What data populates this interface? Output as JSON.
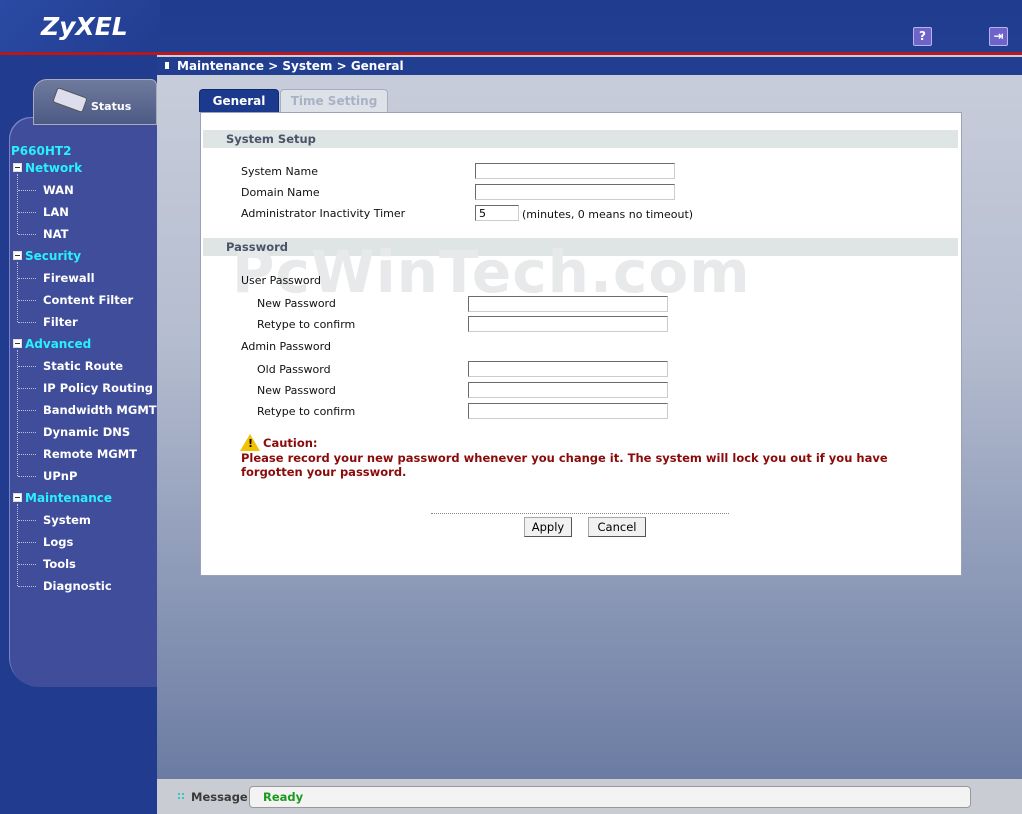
{
  "header": {
    "brand": "ZyXEL",
    "help_icon": "?",
    "logout_icon": "⇥"
  },
  "breadcrumb": "Maintenance > System > General",
  "nav": {
    "status_label": "Status",
    "model": "P660HT2",
    "groups": [
      {
        "label": "Network",
        "items": [
          "WAN",
          "LAN",
          "NAT"
        ]
      },
      {
        "label": "Security",
        "items": [
          "Firewall",
          "Content Filter",
          "Filter"
        ]
      },
      {
        "label": "Advanced",
        "items": [
          "Static Route",
          "IP Policy Routing",
          "Bandwidth MGMT",
          "Dynamic DNS",
          "Remote MGMT",
          "UPnP"
        ]
      },
      {
        "label": "Maintenance",
        "items": [
          "System",
          "Logs",
          "Tools",
          "Diagnostic"
        ]
      }
    ]
  },
  "tabs": {
    "general": "General",
    "time": "Time Setting"
  },
  "system_setup": {
    "title": "System Setup",
    "system_name_label": "System Name",
    "system_name_value": "",
    "domain_name_label": "Domain Name",
    "domain_name_value": "",
    "timer_label": "Administrator Inactivity Timer",
    "timer_value": "5",
    "timer_hint": "(minutes, 0 means no timeout)"
  },
  "password": {
    "title": "Password",
    "user_password_label": "User Password",
    "user_new_label": "New Password",
    "user_retype_label": "Retype to confirm",
    "admin_password_label": "Admin Password",
    "admin_old_label": "Old Password",
    "admin_new_label": "New Password",
    "admin_retype_label": "Retype to confirm"
  },
  "watermark": "PcWinTech.com",
  "caution": {
    "title": "Caution:",
    "text": "Please record your new password whenever you change it. The system will lock you out if you have forgotten your password."
  },
  "buttons": {
    "apply": "Apply",
    "cancel": "Cancel"
  },
  "status": {
    "label": "Message",
    "value": "Ready"
  },
  "colors": {
    "accent": "#1c3a8d",
    "nav_heading": "#28f0ff",
    "caution": "#8b0a0a",
    "ready": "#1b9b1b"
  }
}
